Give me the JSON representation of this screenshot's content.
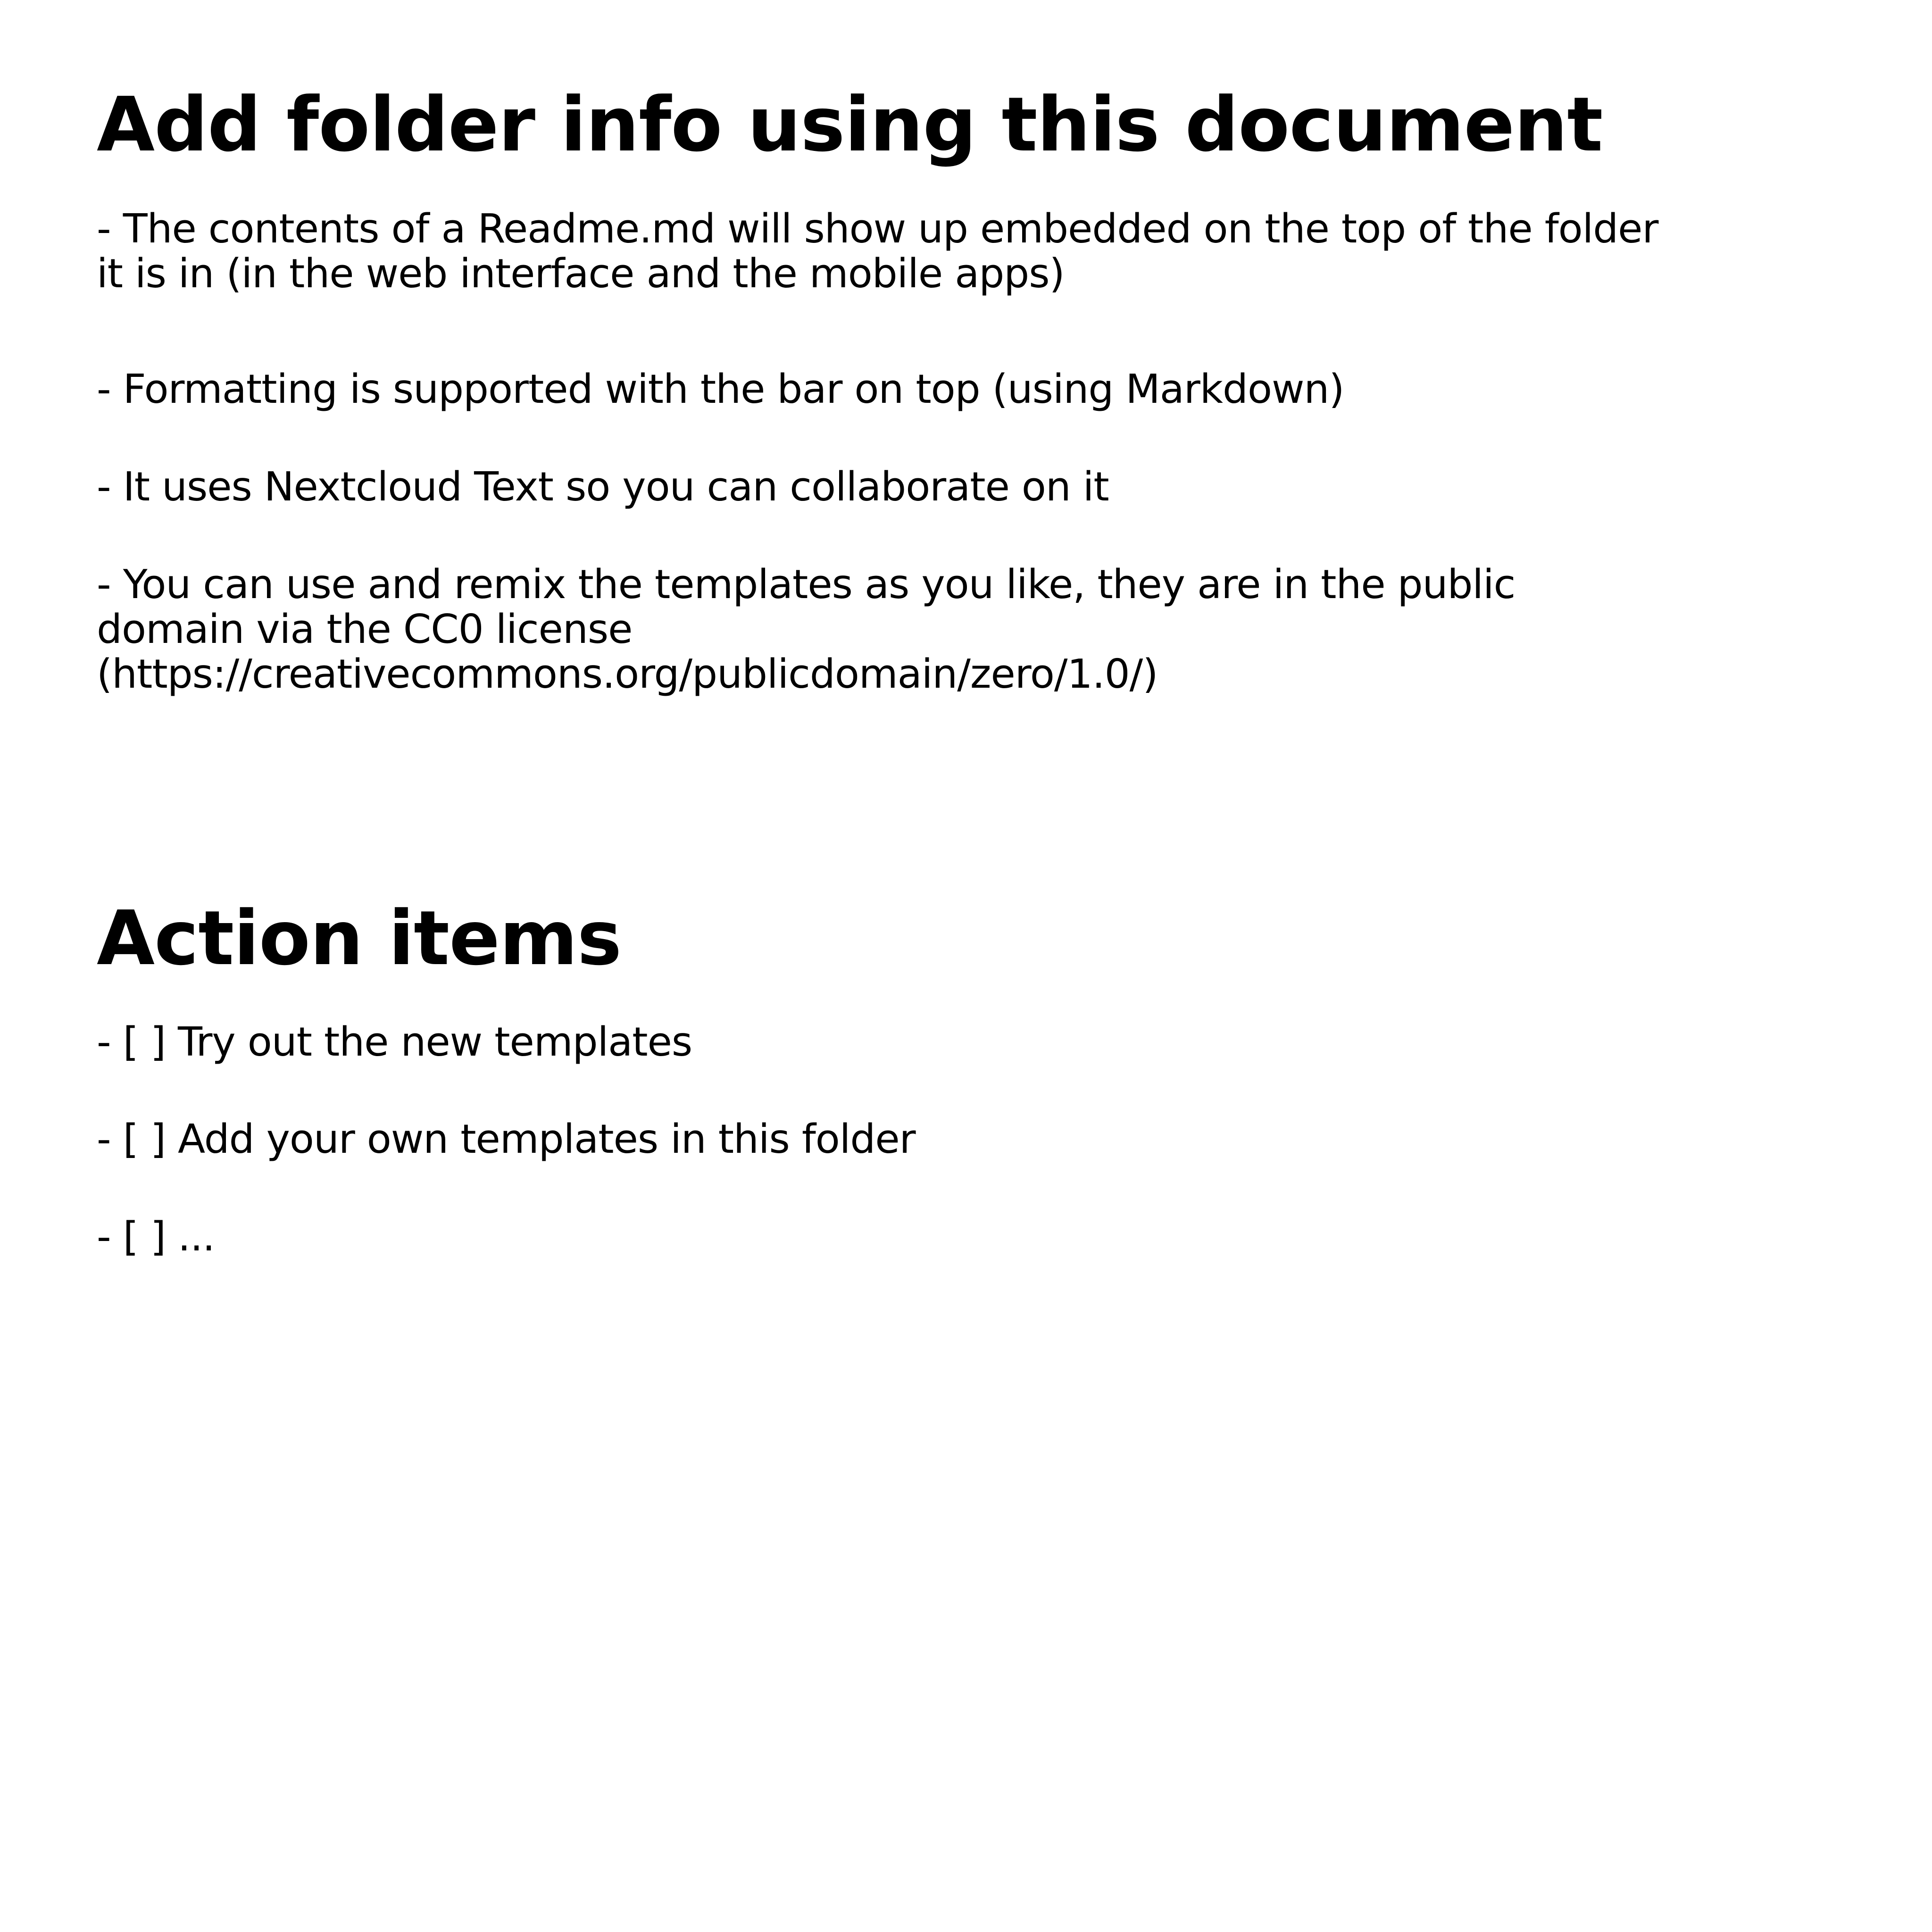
{
  "document": {
    "section1": {
      "heading": "Add folder info using this document",
      "paragraphs": [
        {
          "lines": [
            "- The contents of a Readme.md will show up embedded on the top of the folder",
            "it is in (in the web interface and the mobile apps)"
          ]
        },
        {
          "lines": [
            "- Formatting is supported with the bar on top (using Markdown)"
          ]
        },
        {
          "lines": [
            "- It uses Nextcloud Text so you can collaborate on it"
          ]
        },
        {
          "lines": [
            "- You can use and remix the templates as you like, they are in the public",
            "domain via the CC0 license",
            "(https://creativecommons.org/publicdomain/zero/1.0/)"
          ]
        }
      ]
    },
    "section2": {
      "heading": "Action items",
      "items": [
        "- [ ] Try out the new templates",
        "- [ ] Add your own templates in this folder",
        "- [ ] ..."
      ]
    }
  }
}
